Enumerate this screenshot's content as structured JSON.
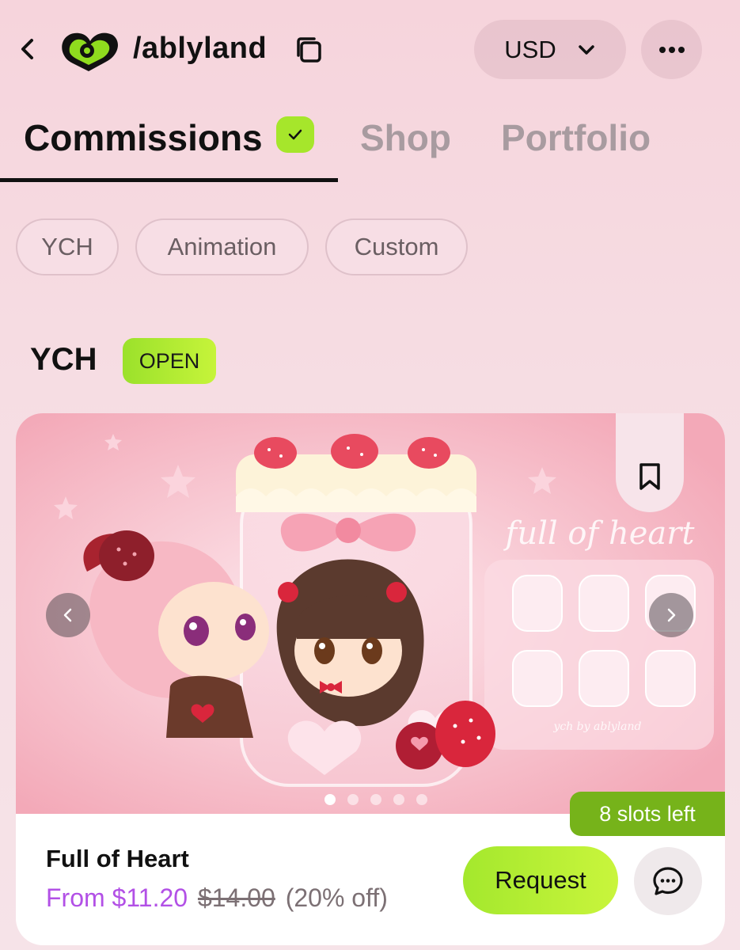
{
  "header": {
    "handle": "/ablyland",
    "currency": "USD",
    "icons": {
      "back": "chevron-left-icon",
      "logo": "ablyland-logo",
      "copy": "copy-icon",
      "currency_dropdown": "chevron-down-icon",
      "more": "more-horizontal-icon"
    }
  },
  "tabs": [
    {
      "label": "Commissions",
      "active": true,
      "verified": true
    },
    {
      "label": "Shop",
      "active": false
    },
    {
      "label": "Portfolio",
      "active": false
    }
  ],
  "filter_chips": [
    "YCH",
    "Animation",
    "Custom"
  ],
  "section": {
    "title": "YCH",
    "status": "OPEN"
  },
  "card": {
    "title": "Full of Heart",
    "price_from": "From $11.20",
    "price_original": "$14.00",
    "discount": "(20% off)",
    "slots_left": "8 slots left",
    "request_label": "Request",
    "image_watermark": "full of heart",
    "image_credit": "ych by ablyland",
    "carousel_total": 5,
    "carousel_active": 1
  },
  "colors": {
    "accent_green": "#a6e62b",
    "slots_green": "#76b31a",
    "price_purple": "#b250e6",
    "background_pink": "#f6d4dc"
  }
}
